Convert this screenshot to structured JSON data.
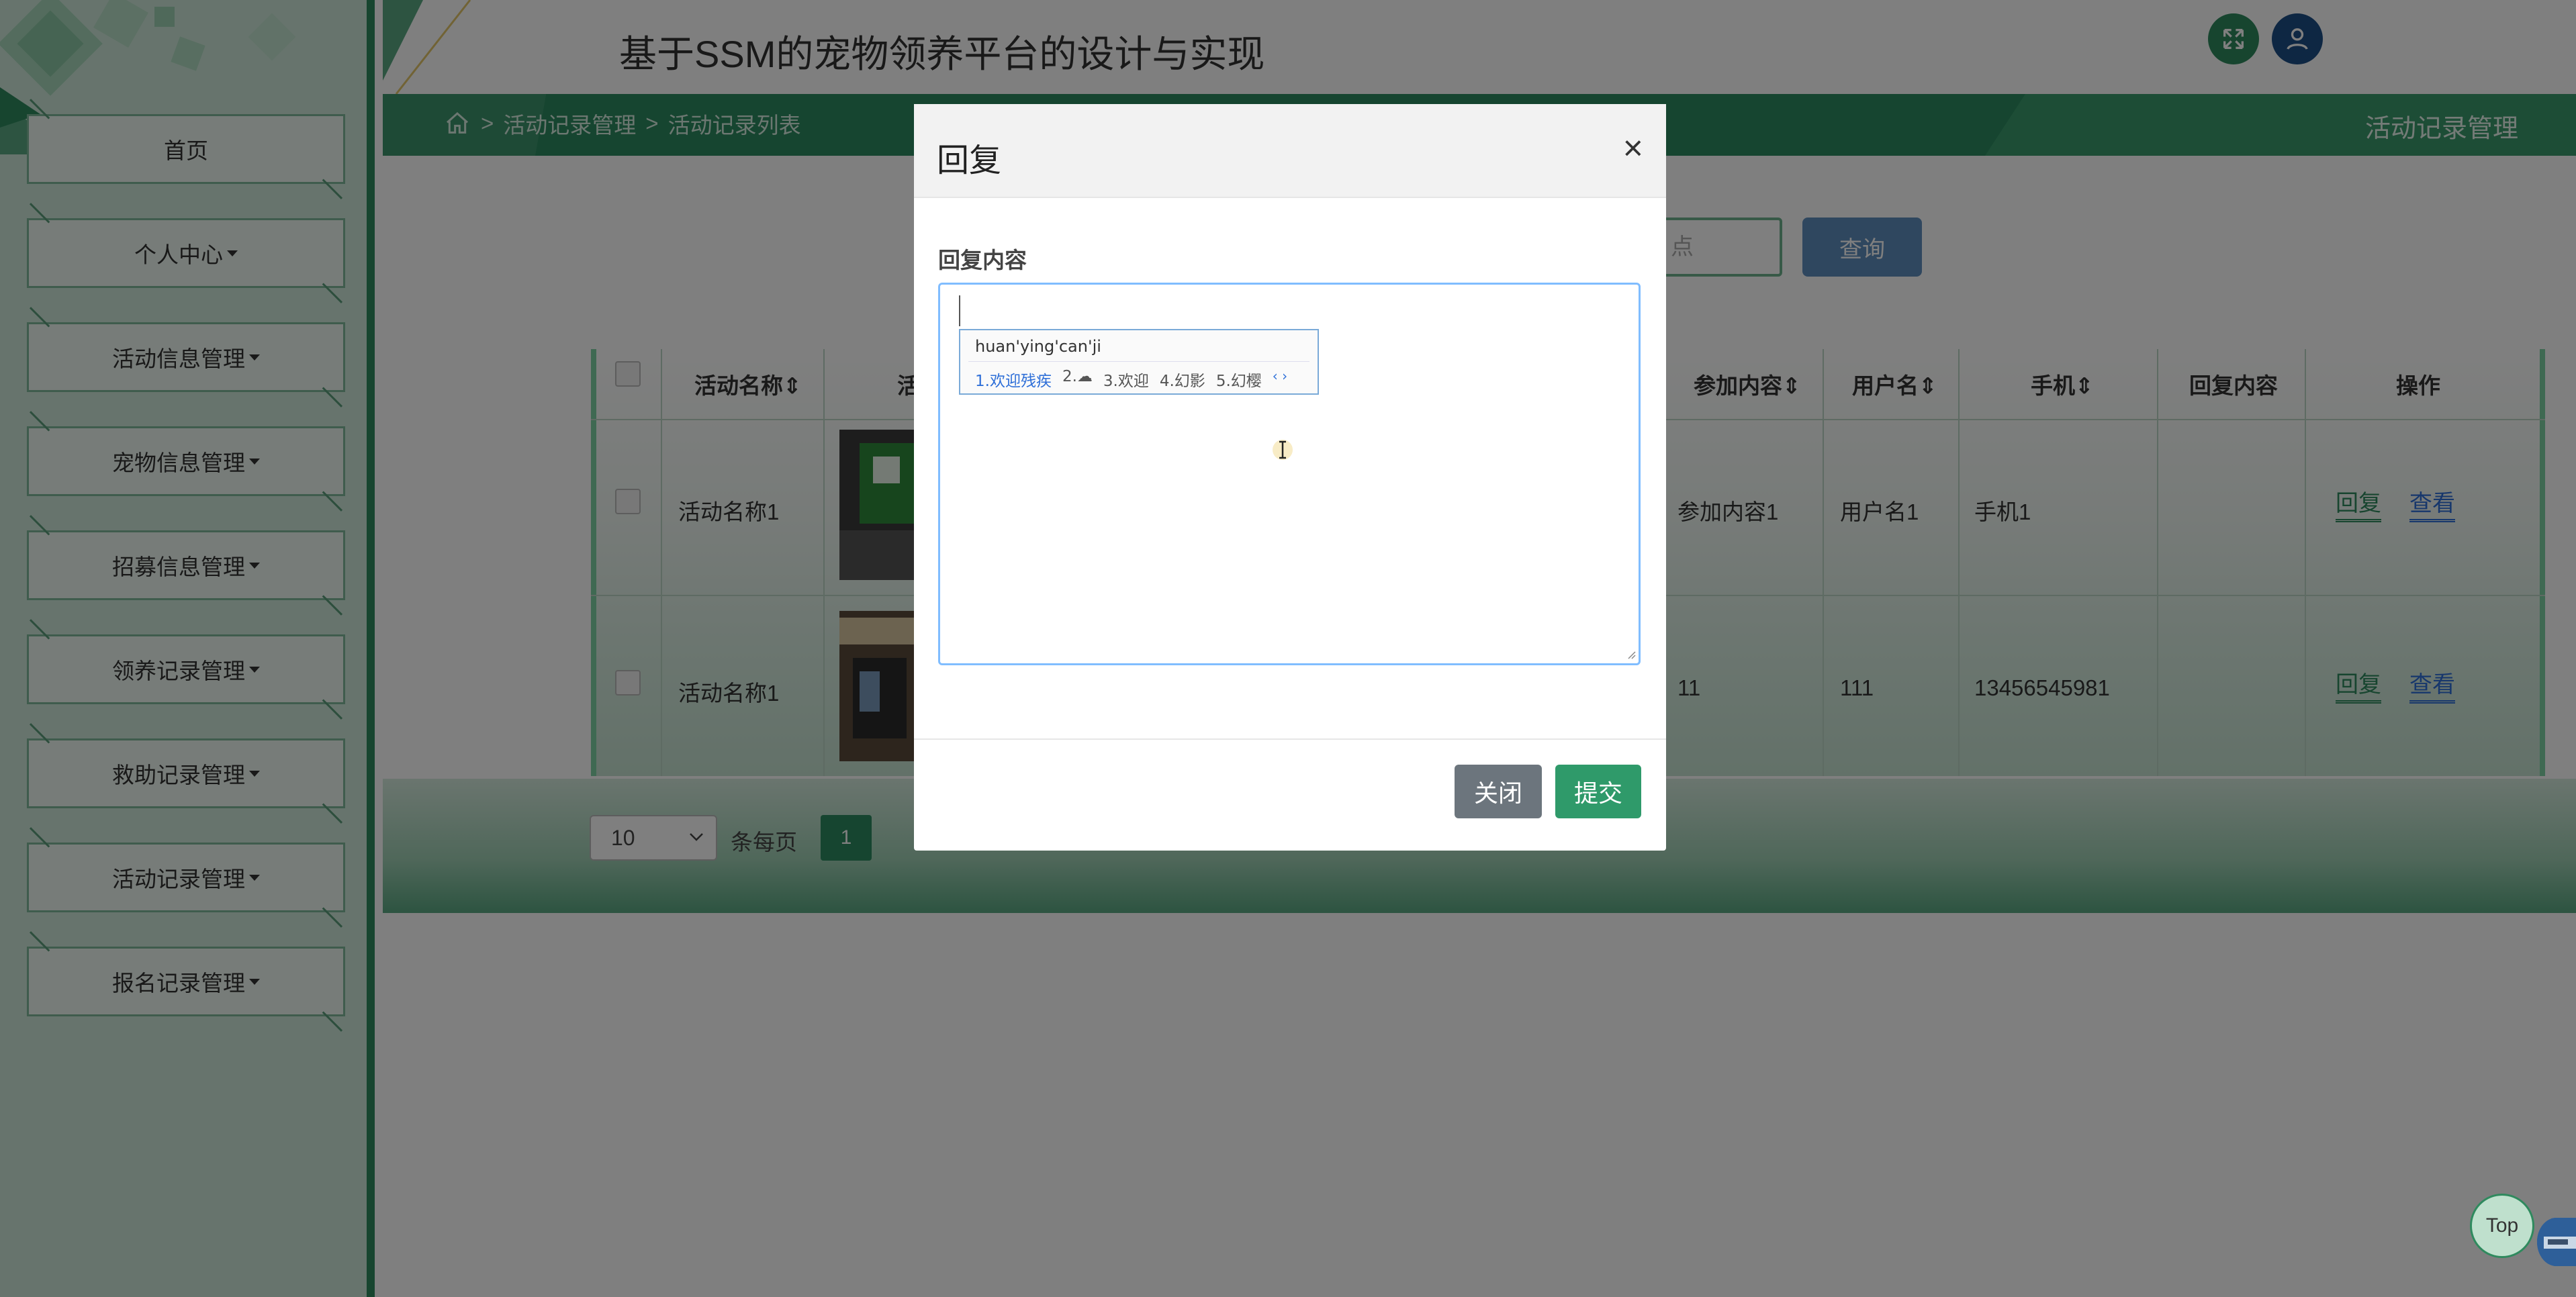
{
  "header": {
    "site_title": "基于SSM的宠物领养平台的设计与实现",
    "icons": [
      "fullscreen-icon",
      "user-icon"
    ]
  },
  "sidebar": {
    "items": [
      {
        "label": "首页",
        "dropdown": false
      },
      {
        "label": "个人中心",
        "dropdown": true
      },
      {
        "label": "活动信息管理",
        "dropdown": true
      },
      {
        "label": "宠物信息管理",
        "dropdown": true
      },
      {
        "label": "招募信息管理",
        "dropdown": true
      },
      {
        "label": "领养记录管理",
        "dropdown": true
      },
      {
        "label": "救助记录管理",
        "dropdown": true
      },
      {
        "label": "活动记录管理",
        "dropdown": true
      },
      {
        "label": "报名记录管理",
        "dropdown": true
      }
    ]
  },
  "breadcrumb": {
    "home_icon": "home-icon",
    "sep": ">",
    "level1": "活动记录管理",
    "level2": "活动记录列表",
    "right_label": "活动记录管理"
  },
  "search": {
    "input_visible_text": "点",
    "button_label": "查询"
  },
  "table": {
    "headers": {
      "name": "活动名称",
      "image_partial": "活",
      "content": "参加内容",
      "username": "用户名",
      "phone": "手机",
      "reply": "回复内容",
      "actions": "操作"
    },
    "rows": [
      {
        "name": "活动名称1",
        "content": "参加内容1",
        "username": "用户名1",
        "phone": "手机1",
        "reply": ""
      },
      {
        "name": "活动名称1",
        "content": "11",
        "username": "111",
        "phone": "13456545981",
        "reply": ""
      }
    ],
    "action_reply": "回复",
    "action_view": "查看"
  },
  "pager": {
    "page_size": "10",
    "per_page_label": "条每页",
    "current_page": "1"
  },
  "modal": {
    "title": "回复",
    "close_symbol": "×",
    "field_label": "回复内容",
    "close_button": "关闭",
    "submit_button": "提交"
  },
  "ime": {
    "pinyin": "huan'ying'can'ji",
    "candidates": [
      "1.欢迎残疾",
      "2.☁",
      "3.欢迎",
      "4.幻影",
      "5.幻樱"
    ],
    "arrows": "‹ ›"
  },
  "float": {
    "top_label": "Top"
  },
  "colors": {
    "brand_green": "#2d8b60",
    "submit_green": "#2f9a6a",
    "close_gray": "#6c757d",
    "query_blue": "#5f8fbf",
    "link_blue": "#2e6fd8"
  }
}
